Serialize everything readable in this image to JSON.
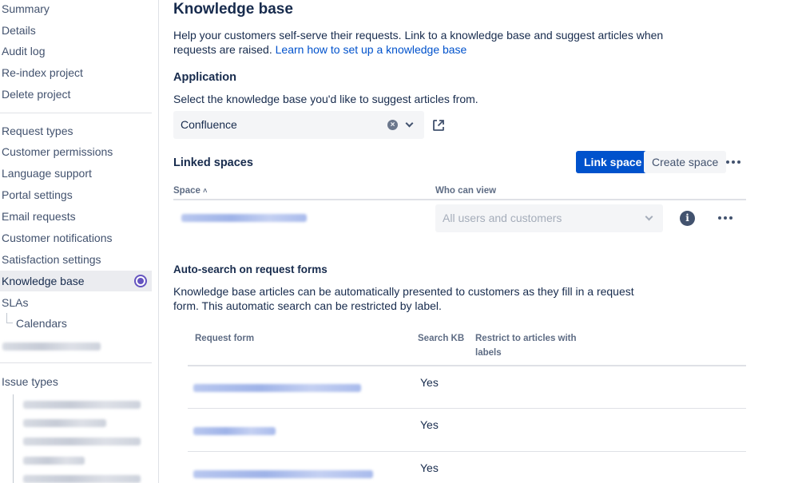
{
  "sidebar": {
    "items_top": [
      "Summary",
      "Details",
      "Audit log",
      "Re-index project",
      "Delete project"
    ],
    "items_mid": [
      "Request types",
      "Customer permissions",
      "Language support",
      "Portal settings",
      "Email requests",
      "Customer notifications",
      "Satisfaction settings",
      "Knowledge base",
      "SLAs"
    ],
    "sub_item": "Calendars",
    "issue_types_label": "Issue types",
    "active_item": "Knowledge base"
  },
  "page": {
    "title": "Knowledge base",
    "description": "Help your customers self-serve their requests. Link to a knowledge base and suggest articles when requests are raised.",
    "learn_link": "Learn how to set up a knowledge base"
  },
  "application": {
    "heading": "Application",
    "helper": "Select the knowledge base you'd like to suggest articles from.",
    "selected": "Confluence"
  },
  "linked_spaces": {
    "heading": "Linked spaces",
    "link_button": "Link space",
    "create_button": "Create space",
    "columns": {
      "space": "Space",
      "sort_indicator": "˄",
      "who_can_view": "Who can view"
    },
    "row_view_value": "All users and customers"
  },
  "auto_search": {
    "heading": "Auto-search on request forms",
    "description": "Knowledge base articles can be automatically presented to customers as they fill in a request form. This automatic search can be restricted by label.",
    "columns": {
      "request_form": "Request form",
      "search_kb": "Search KB",
      "restrict_line1": "Restrict to articles with",
      "restrict_line2": "labels"
    },
    "rows": [
      {
        "search_kb": "Yes"
      },
      {
        "search_kb": "Yes"
      },
      {
        "search_kb": "Yes"
      }
    ]
  },
  "colors": {
    "primary": "#0052cc",
    "active_indicator": "#6554c0",
    "text": "#172b4d",
    "subtle": "#42526e"
  }
}
